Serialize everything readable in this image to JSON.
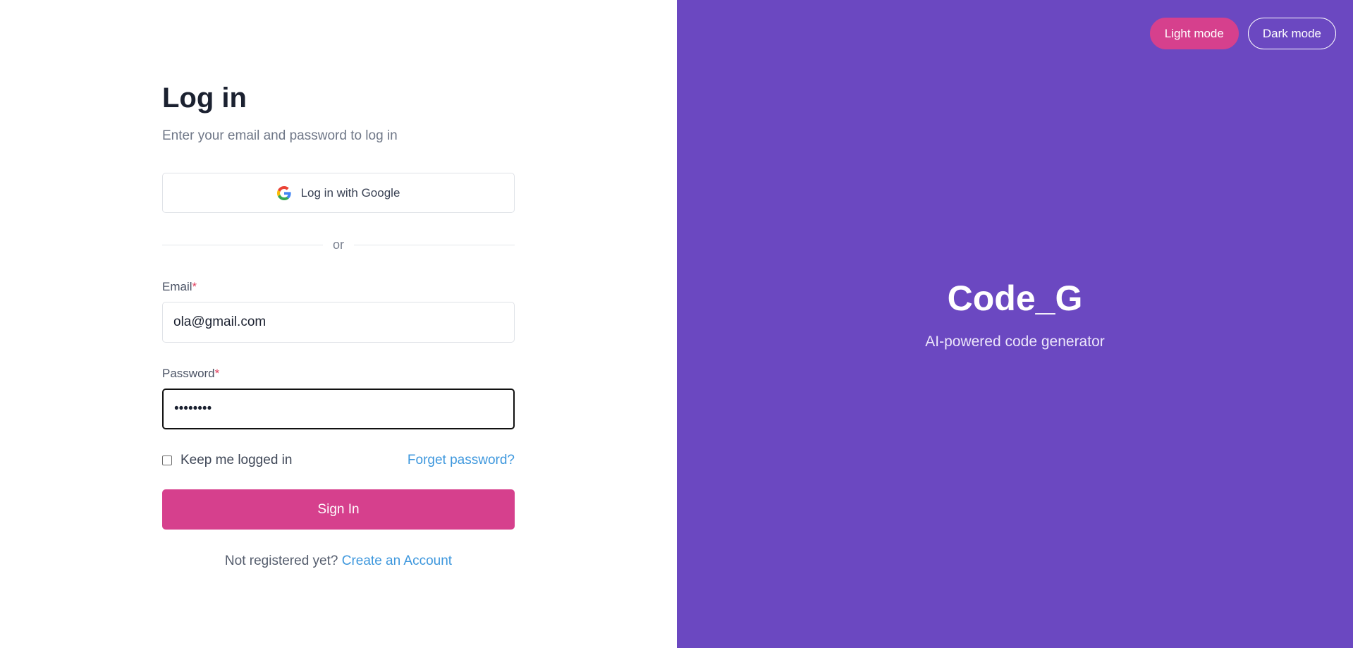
{
  "login": {
    "title": "Log in",
    "subtitle": "Enter your email and password to log in",
    "google_button_label": "Log in with Google",
    "divider_text": "or",
    "email": {
      "label": "Email",
      "required_marker": "*",
      "value": "ola@gmail.com"
    },
    "password": {
      "label": "Password",
      "required_marker": "*",
      "value": "••••••••"
    },
    "keep_logged_in_label": "Keep me logged in",
    "forget_password_label": "Forget password?",
    "sign_in_label": "Sign In",
    "not_registered_text": "Not registered yet?",
    "create_account_label": "Create an Account"
  },
  "theme_switch": {
    "light_label": "Light mode",
    "dark_label": "Dark mode"
  },
  "brand": {
    "name": "Code_G",
    "tagline": "AI-powered code generator"
  },
  "colors": {
    "accent": "#d6408d",
    "brand_panel": "#6b48c1",
    "link": "#3d97dd"
  },
  "icons": {
    "google": "google-icon"
  }
}
